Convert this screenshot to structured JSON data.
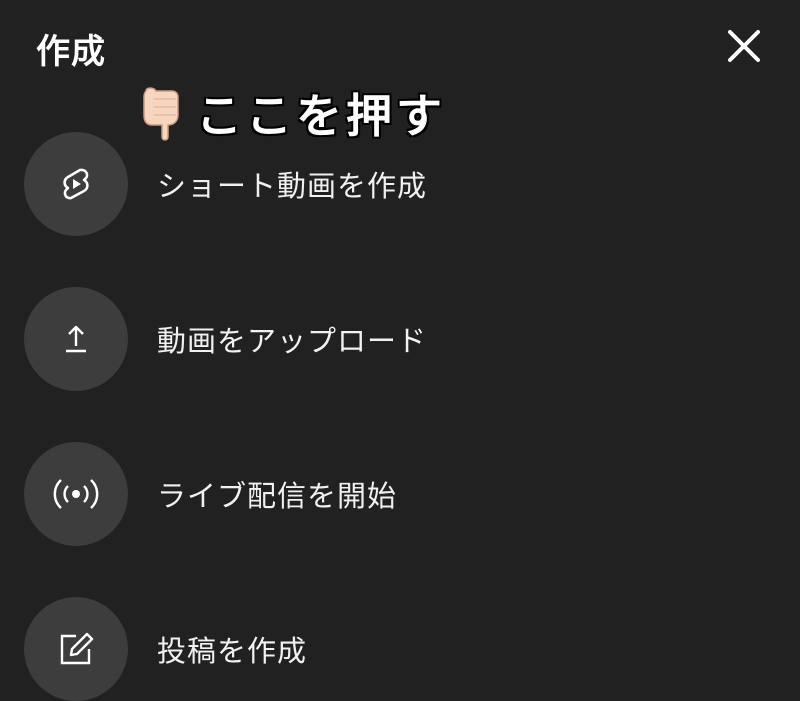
{
  "header": {
    "title": "作成"
  },
  "annotation": {
    "text": "ここを押す"
  },
  "menu": {
    "items": [
      {
        "label": "ショート動画を作成",
        "icon": "shorts-icon"
      },
      {
        "label": "動画をアップロード",
        "icon": "upload-icon"
      },
      {
        "label": "ライブ配信を開始",
        "icon": "live-broadcast-icon"
      },
      {
        "label": "投稿を作成",
        "icon": "edit-post-icon"
      }
    ]
  },
  "colors": {
    "background": "#212121",
    "icon_circle": "#3d3d3d",
    "text": "#f1f1f1"
  }
}
